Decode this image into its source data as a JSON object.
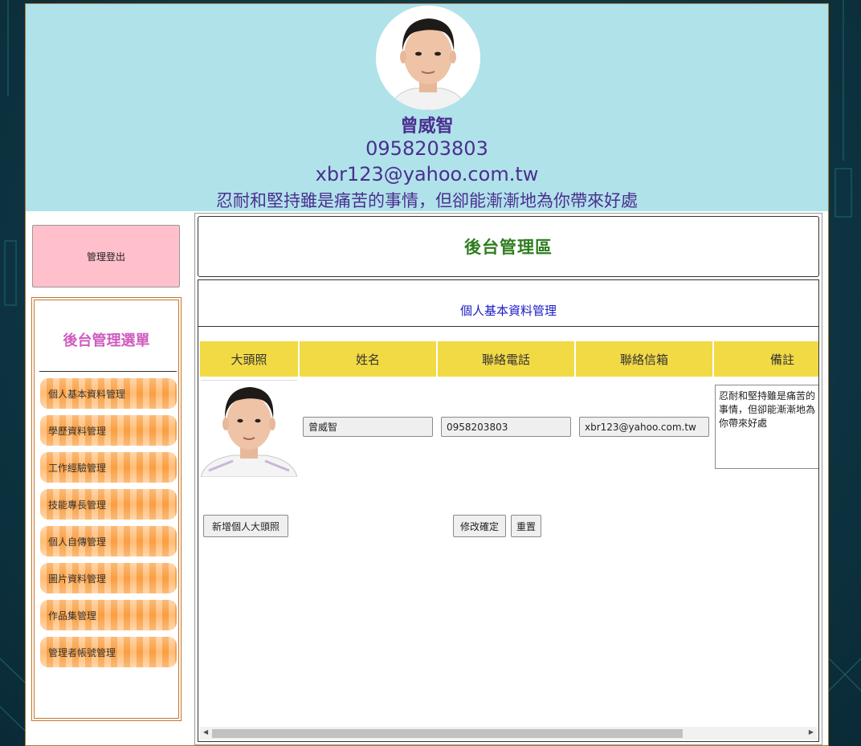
{
  "header": {
    "name": "曾威智",
    "phone": "0958203803",
    "email": "xbr123@yahoo.com.tw",
    "motto": "忍耐和堅持雖是痛苦的事情，但卻能漸漸地為你帶來好處",
    "bg_color": "#b0e2ea",
    "text_color": "#4b2f8f"
  },
  "sidebar": {
    "logout_label": "管理登出",
    "menu_title": "後台管理選單",
    "items": [
      {
        "label": "個人基本資料管理"
      },
      {
        "label": "學歷資料管理"
      },
      {
        "label": "工作經驗管理"
      },
      {
        "label": "技能專長管理"
      },
      {
        "label": "個人自傳管理"
      },
      {
        "label": "圖片資料管理"
      },
      {
        "label": "作品集管理"
      },
      {
        "label": "管理者帳號管理"
      }
    ]
  },
  "main": {
    "title": "後台管理區",
    "section_title": "個人基本資料管理",
    "columns": [
      "大頭照",
      "姓名",
      "聯絡電話",
      "聯絡信箱",
      "備註"
    ],
    "row": {
      "name": "曾威智",
      "phone": "0958203803",
      "email": "xbr123@yahoo.com.tw",
      "note": "忍耐和堅持雖是痛苦的事情，但卻能漸漸地為你帶來好處"
    },
    "buttons": {
      "add_photo": "新增個人大頭照",
      "confirm": "修改確定",
      "reset": "重置"
    }
  },
  "icons": {
    "scroll_left": "scroll-left-arrow-icon",
    "scroll_right": "scroll-right-arrow-icon"
  }
}
